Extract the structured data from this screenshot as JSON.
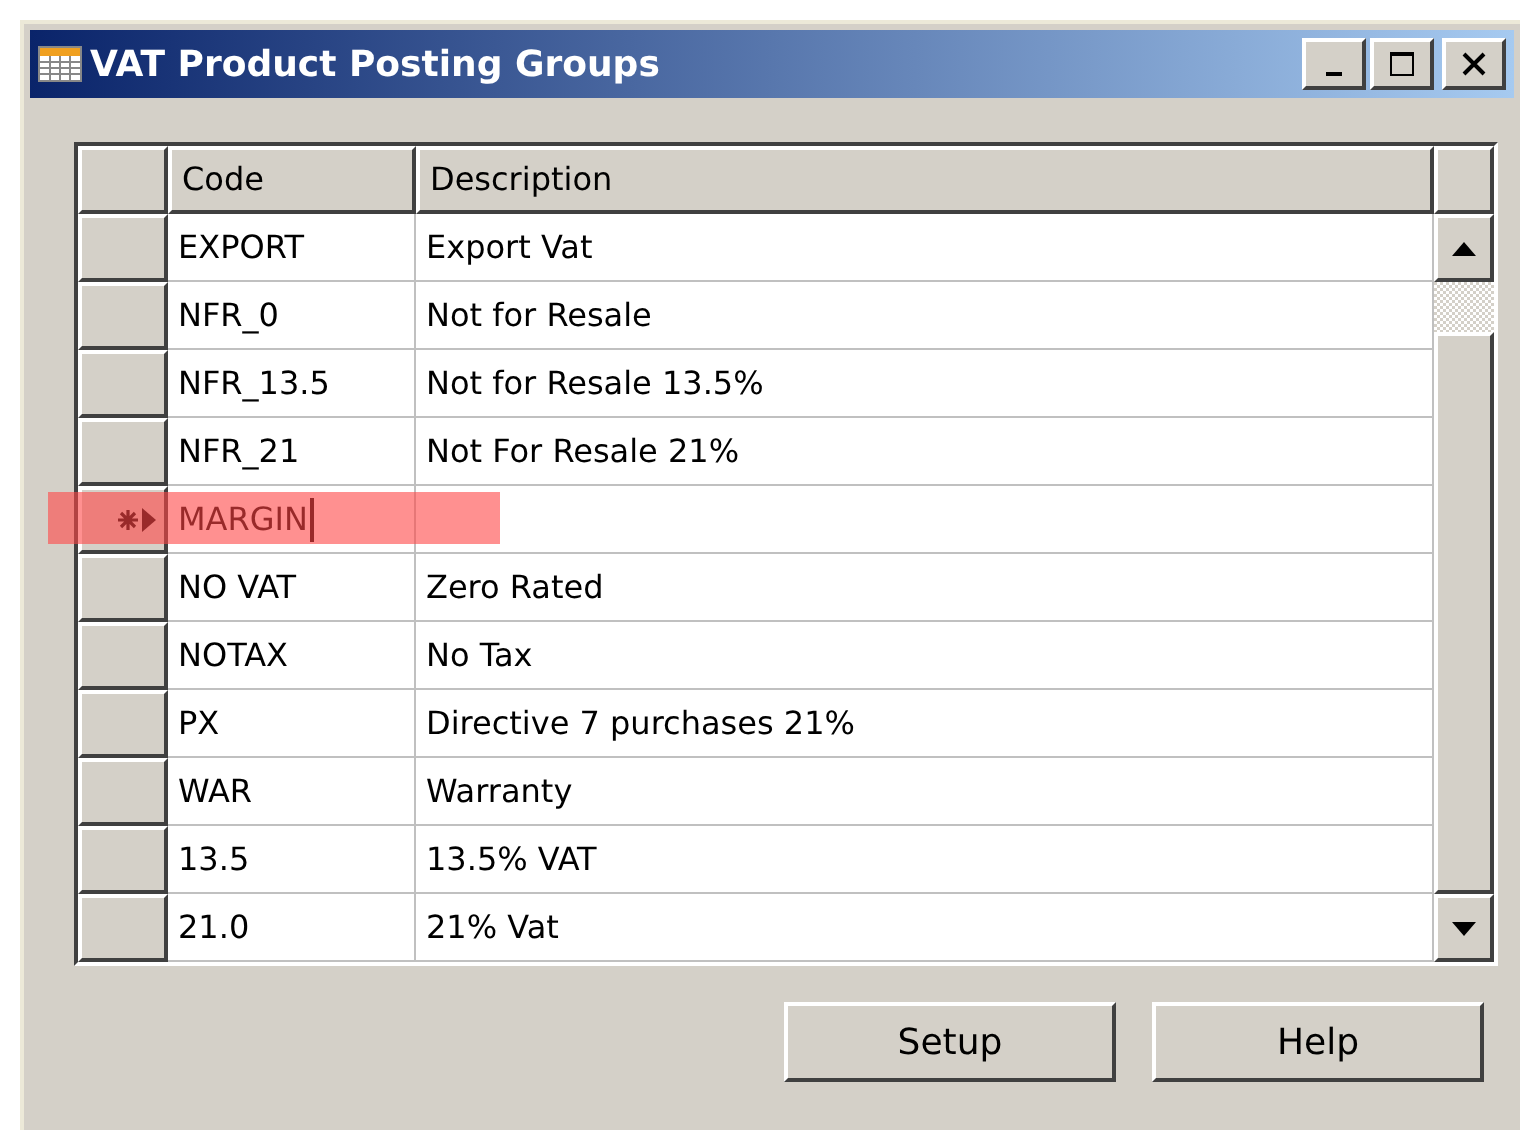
{
  "window": {
    "title": "VAT Product Posting Groups"
  },
  "table": {
    "columns": [
      "Code",
      "Description"
    ],
    "rows": [
      {
        "code": "EXPORT",
        "description": "Export Vat",
        "selected": false,
        "new": false,
        "highlighted": false
      },
      {
        "code": "NFR_0",
        "description": "Not for Resale",
        "selected": false,
        "new": false,
        "highlighted": false
      },
      {
        "code": "NFR_13.5",
        "description": "Not for Resale 13.5%",
        "selected": false,
        "new": false,
        "highlighted": false
      },
      {
        "code": "NFR_21",
        "description": "Not For Resale 21%",
        "selected": false,
        "new": false,
        "highlighted": false
      },
      {
        "code": "MARGIN",
        "selected": true,
        "new": true,
        "highlighted": true
      },
      {
        "code": "NO VAT",
        "description": "Zero Rated",
        "selected": false,
        "new": false,
        "highlighted": false
      },
      {
        "code": "NOTAX",
        "description": "No Tax",
        "selected": false,
        "new": false,
        "highlighted": false
      },
      {
        "code": "PX",
        "description": "Directive 7 purchases 21%",
        "selected": false,
        "new": false,
        "highlighted": false
      },
      {
        "code": "WAR",
        "description": "Warranty",
        "selected": false,
        "new": false,
        "highlighted": false
      },
      {
        "code": "13.5",
        "description": "13.5%  VAT",
        "selected": false,
        "new": false,
        "highlighted": false
      },
      {
        "code": "21.0",
        "description": "21%  Vat",
        "selected": false,
        "new": false,
        "highlighted": false
      }
    ]
  },
  "buttons": [
    "Setup",
    "Help"
  ]
}
